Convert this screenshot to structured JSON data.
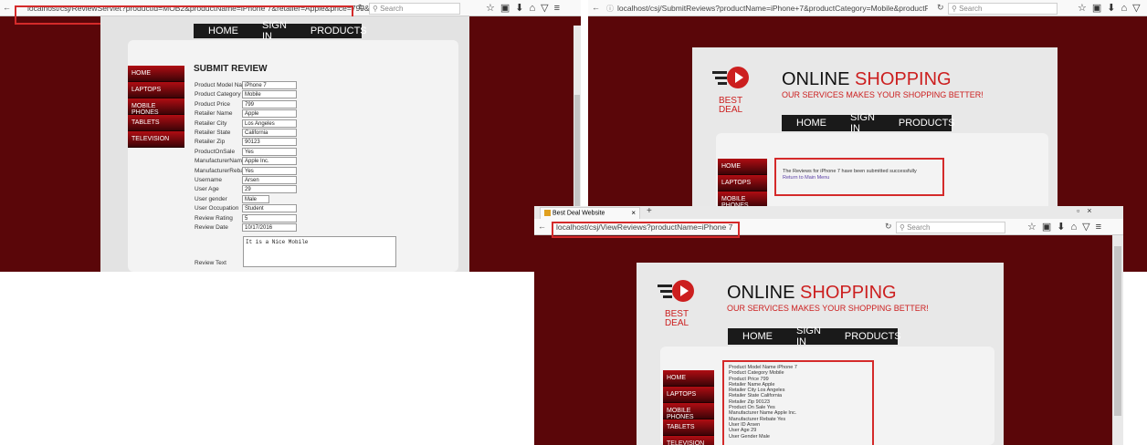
{
  "left": {
    "url": "localhost/csj/ReviewServlet?productId=MOB2&productName=iPhone 7&retailer=Apple&price=799&category=",
    "search_placeholder": "Search",
    "nav": [
      "HOME",
      "SIGN IN",
      "PRODUCTS"
    ],
    "menu": [
      "HOME",
      "LAPTOPS",
      "MOBILE PHONES",
      "TABLETS",
      "TELEVISION"
    ],
    "heading": "SUBMIT REVIEW",
    "fields": [
      {
        "label": "Product Model Name",
        "value": "iPhone 7"
      },
      {
        "label": "Product Category",
        "value": "Mobile"
      },
      {
        "label": "Product Price",
        "value": "799"
      },
      {
        "label": "Retailer Name",
        "value": "Apple"
      },
      {
        "label": "Retailer City",
        "value": "Los Angeles"
      },
      {
        "label": "Retailer State",
        "value": "California"
      },
      {
        "label": "Retailer Zip",
        "value": "90123"
      },
      {
        "label": "ProductOnSale",
        "value": "Yes"
      },
      {
        "label": "ManufacturerName",
        "value": "Apple Inc."
      },
      {
        "label": "ManufacturerRebate",
        "value": "Yes"
      },
      {
        "label": "Username",
        "value": "Arsen"
      },
      {
        "label": "User Age",
        "value": "29"
      },
      {
        "label": "User gender",
        "value": "Male"
      },
      {
        "label": "User Occupation",
        "value": "Student"
      },
      {
        "label": "Review Rating",
        "value": "5"
      },
      {
        "label": "Review Date",
        "value": "10/17/2016"
      }
    ],
    "review_text_label": "Review Text",
    "review_text_value": "It is a Nice Mobile"
  },
  "right": {
    "url": "localhost/csj/SubmitReviews?productName=iPhone+7&productCategory=Mobile&productPrice=799&retailerN",
    "search_placeholder": "Search",
    "site_title_1": "ONLINE ",
    "site_title_2": "SHOPPING",
    "site_subtitle": "OUR SERVICES MAKES YOUR SHOPPING BETTER!",
    "best": "BEST",
    "deal": "DEAL",
    "nav": [
      "HOME",
      "SIGN IN",
      "PRODUCTS"
    ],
    "menu": [
      "HOME",
      "LAPTOPS",
      "MOBILE PHONES"
    ],
    "message": "The Reviews for iPhone 7 have been submitted successfully",
    "return_link": "Return to Main Menu"
  },
  "bottom": {
    "tab_title": "Best Deal Website",
    "url": "localhost/csj/ViewReviews?productName=iPhone 7",
    "search_placeholder": "Search",
    "site_title_1": "ONLINE ",
    "site_title_2": "SHOPPING",
    "site_subtitle": "OUR SERVICES MAKES YOUR SHOPPING BETTER!",
    "best": "BEST",
    "deal": "DEAL",
    "nav": [
      "HOME",
      "SIGN IN",
      "PRODUCTS"
    ],
    "menu": [
      "HOME",
      "LAPTOPS",
      "MOBILE PHONES",
      "TABLETS",
      "TELEVISION"
    ],
    "review_lines": [
      "Product Model Name iPhone 7",
      "Product Category Mobile",
      "Product Price 799",
      "Retailer Name Apple",
      "Retailer City Los Angeles",
      "Retailer State California",
      "Retailer Zip 90123",
      "Product On Sale Yes",
      "Manufacturer Name Apple Inc.",
      "Manufacturer Rebate Yes",
      "User ID Arsen",
      "User Age 29",
      "User Gender Male"
    ]
  },
  "colors": {
    "maroon": "#5a0609",
    "accent_red": "#cc1f1f",
    "highlight_box": "#d42a2a"
  }
}
